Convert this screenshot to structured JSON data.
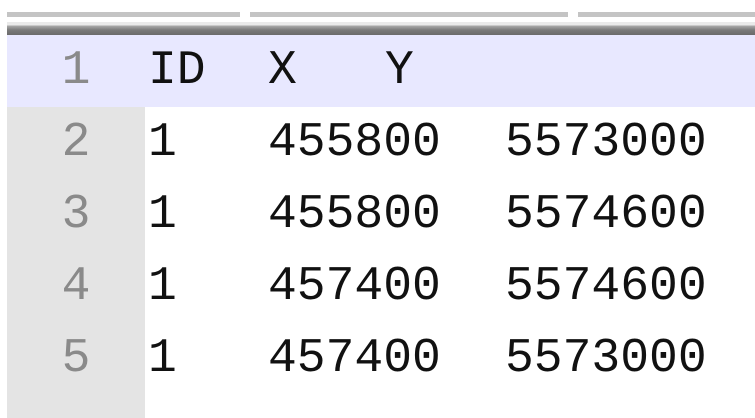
{
  "editor": {
    "lines": [
      {
        "number": "1",
        "cells": [
          "ID",
          "X",
          "Y"
        ]
      },
      {
        "number": "2",
        "cells": [
          "1",
          "455800",
          "5573000"
        ]
      },
      {
        "number": "3",
        "cells": [
          "1",
          "455800",
          "5574600"
        ]
      },
      {
        "number": "4",
        "cells": [
          "1",
          "457400",
          "5574600"
        ]
      },
      {
        "number": "5",
        "cells": [
          "1",
          "457400",
          "5573000"
        ]
      }
    ],
    "current_line_color": "#e8e8ff"
  }
}
